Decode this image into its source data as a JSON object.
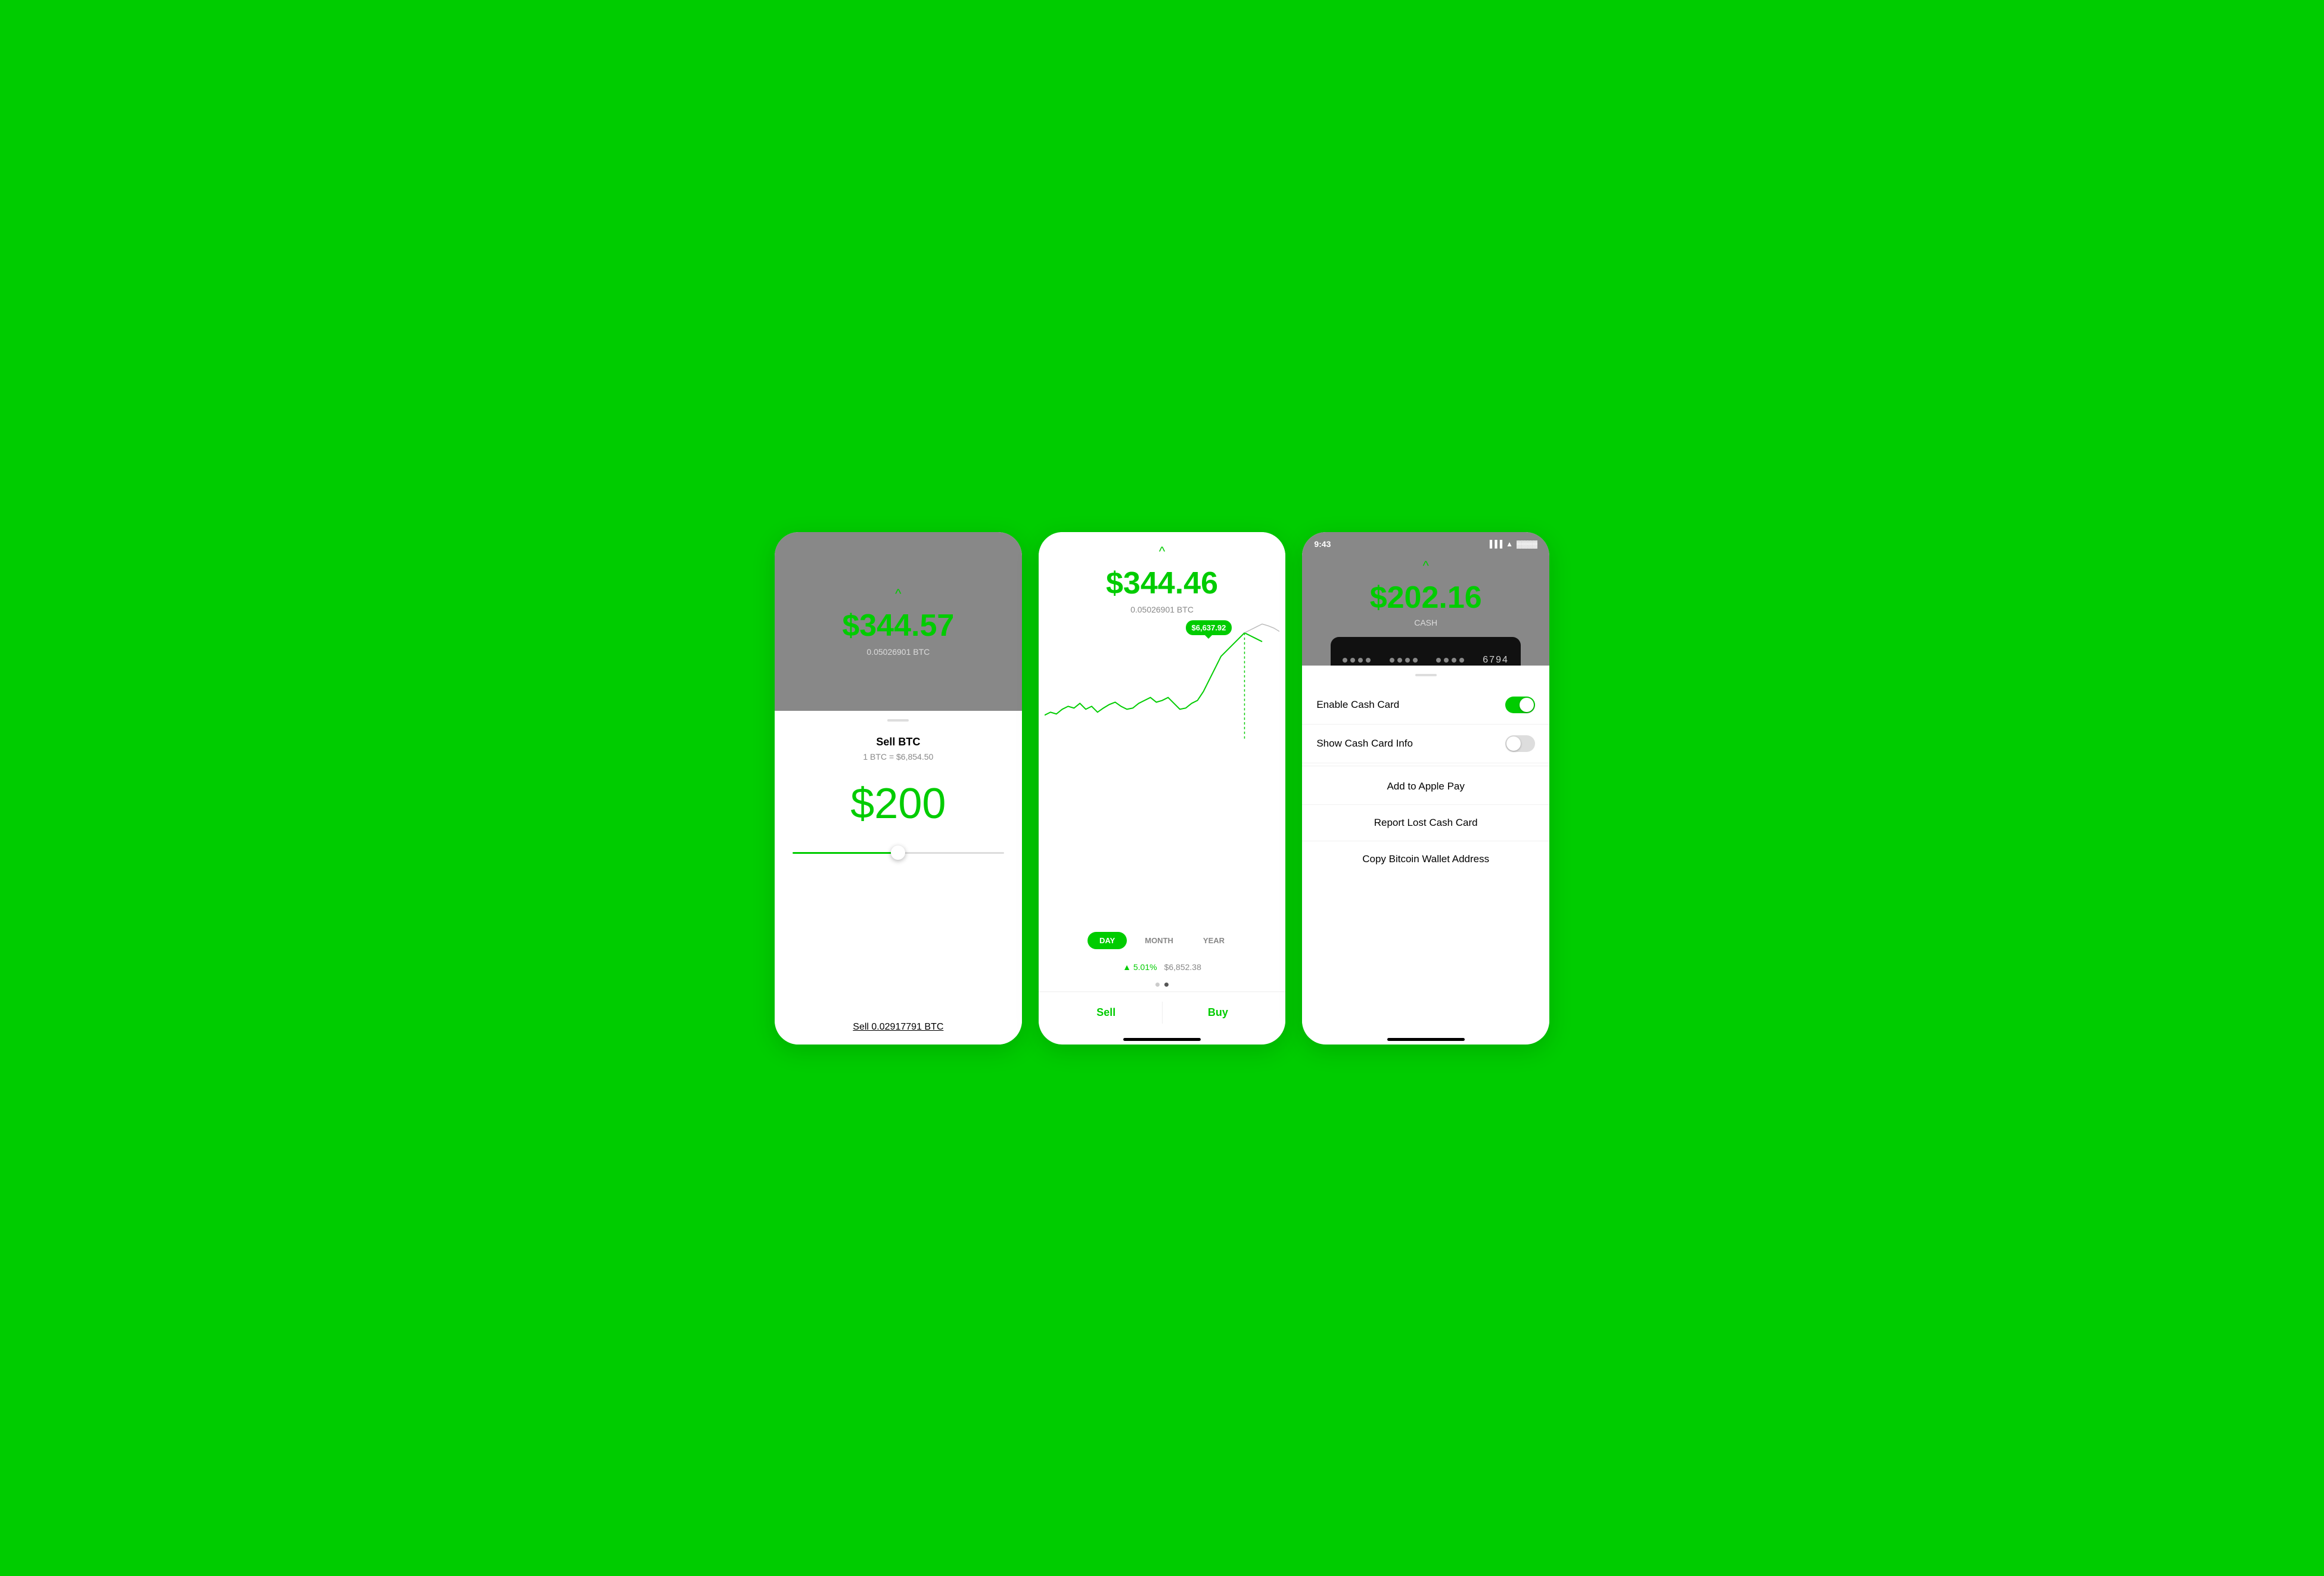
{
  "app": {
    "background_color": "#00CC00"
  },
  "screen1": {
    "btc_value": "$344.57",
    "btc_amount": "0.05026901 BTC",
    "chevron": "^",
    "title": "Sell BTC",
    "rate": "1 BTC = $6,854.50",
    "sell_amount": "$200",
    "sell_btc_label": "Sell 0.02917791 BTC"
  },
  "screen2": {
    "btc_value": "$344.46",
    "btc_amount": "0.05026901 BTC",
    "chevron": "^",
    "chart_tooltip": "$6,637.92",
    "tabs": [
      "DAY",
      "MONTH",
      "YEAR"
    ],
    "active_tab": "DAY",
    "price_change": "▲ 5.01%",
    "price_value": "$6,852.38",
    "sell_label": "Sell",
    "buy_label": "Buy"
  },
  "screen3": {
    "status_time": "9:43",
    "cash_value": "$202.16",
    "cash_subtitle": "CASH",
    "card_last4": "6794",
    "chevron": "^",
    "menu_items": [
      {
        "label": "Enable Cash Card",
        "type": "toggle",
        "state": "on"
      },
      {
        "label": "Show Cash Card Info",
        "type": "toggle",
        "state": "off"
      },
      {
        "label": "Add to Apple Pay",
        "type": "center"
      },
      {
        "label": "Report Lost Cash Card",
        "type": "center"
      },
      {
        "label": "Copy Bitcoin Wallet Address",
        "type": "center"
      }
    ]
  }
}
